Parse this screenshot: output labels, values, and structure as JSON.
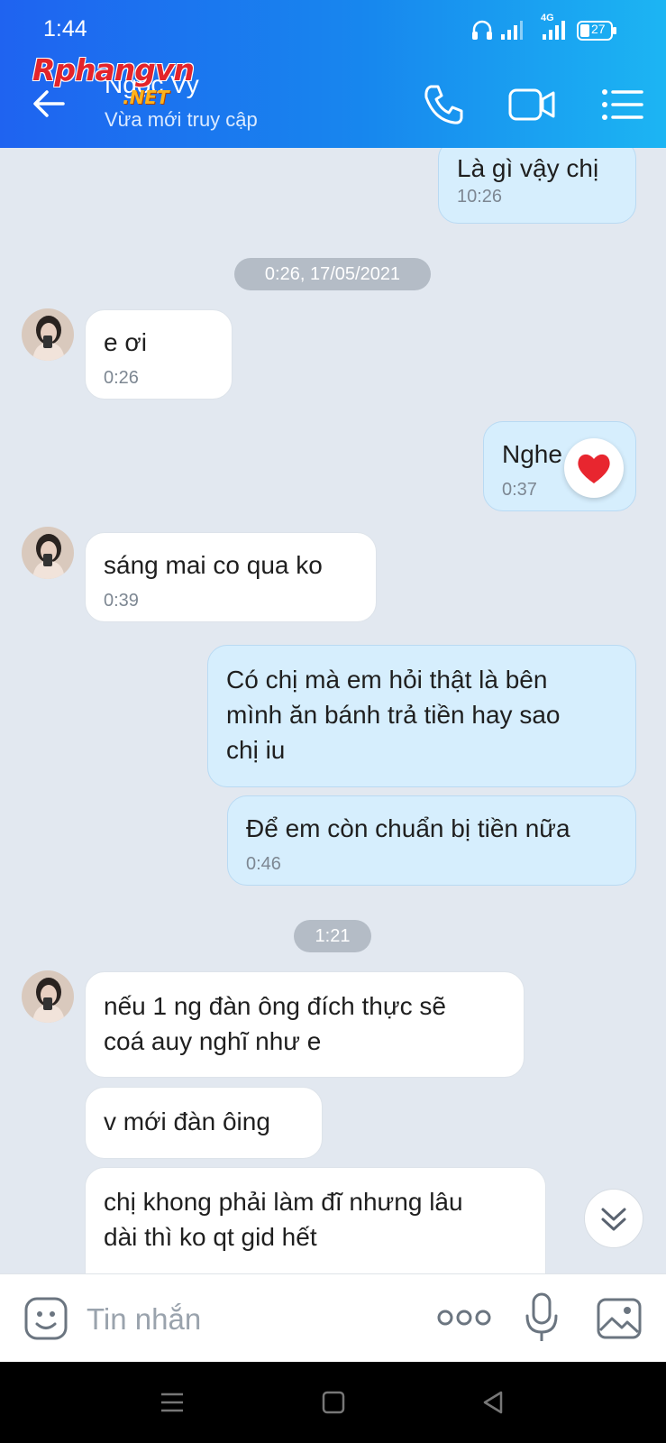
{
  "status": {
    "time": "1:44",
    "network": "4G",
    "battery": "27"
  },
  "header": {
    "contact_name": "Ngọc Vy",
    "contact_status": "Vừa mới truy cập",
    "watermark_main": "Rphangvn",
    "watermark_sub": ".NET"
  },
  "messages": [
    {
      "dir": "sent",
      "text": "Là gì vậy chị",
      "time": "10:26"
    },
    {
      "dir": "separator",
      "text": "0:26, 17/05/2021"
    },
    {
      "dir": "recv",
      "text": " e ơi",
      "time": "0:26"
    },
    {
      "dir": "sent",
      "text": "Nghe chị",
      "time": "0:37",
      "reaction": "heart"
    },
    {
      "dir": "recv",
      "text": "sáng mai co qua ko",
      "time": "0:39"
    },
    {
      "dir": "sent",
      "lines": [
        "Có chị mà em hỏi thật là bên",
        "mình ăn bánh trả tiền hay sao",
        "chị iu"
      ]
    },
    {
      "dir": "sent",
      "text": "Để em còn chuẩn bị tiền nữa",
      "time": "0:46"
    },
    {
      "dir": "separator",
      "text": "1:21"
    },
    {
      "dir": "recv",
      "lines": [
        "nếu 1 ng đàn ông đích thực sẽ",
        "coá auy nghĩ như e"
      ]
    },
    {
      "dir": "recv",
      "text": "v mới đàn ôing"
    },
    {
      "dir": "recv",
      "lines": [
        "chị khong phải làm đĩ nhưng lâu",
        "dài thì ko qt gid hết"
      ]
    }
  ],
  "composer": {
    "placeholder": "Tin nhắn"
  },
  "colors": {
    "header_start": "#1f63f0",
    "header_end": "#1cb5f3",
    "sent_bubble": "#d6eefd",
    "recv_bubble": "#ffffff",
    "chat_bg": "#e2e8f0"
  }
}
